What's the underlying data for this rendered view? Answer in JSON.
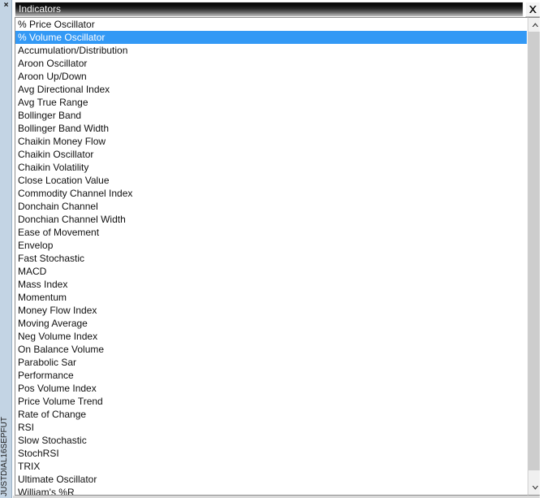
{
  "window": {
    "title": "Indicators",
    "close_icon": "close-icon",
    "close_label": "×"
  },
  "side_strip": {
    "close_label": "×",
    "close_icon": "close-icon",
    "label": "JUSTDIAL16SEPFUT"
  },
  "scrollbar": {
    "up_icon": "chevron-up-icon",
    "down_icon": "chevron-down-icon"
  },
  "colors": {
    "selection": "#3399f5",
    "selection_text": "#ffffff",
    "titlebar_text": "#ffffff",
    "list_background": "#ffffff",
    "list_text": "#101010",
    "side_strip": "#c3d4e4",
    "scrollbar_thumb": "#cdcdcd"
  },
  "list": {
    "selected_index": 1,
    "items": [
      "% Price Oscillator",
      "% Volume Oscillator",
      "Accumulation/Distribution",
      "Aroon Oscillator",
      "Aroon Up/Down",
      "Avg Directional Index",
      "Avg True Range",
      "Bollinger Band",
      "Bollinger Band Width",
      "Chaikin Money Flow",
      "Chaikin Oscillator",
      "Chaikin Volatility",
      "Close Location Value",
      "Commodity Channel Index",
      "Donchain Channel",
      "Donchian Channel Width",
      "Ease of Movement",
      "Envelop",
      "Fast Stochastic",
      "MACD",
      "Mass Index",
      "Momentum",
      "Money Flow Index",
      "Moving Average",
      "Neg Volume Index",
      "On Balance Volume",
      "Parabolic Sar",
      "Performance",
      "Pos Volume Index",
      "Price Volume Trend",
      "Rate of Change",
      "RSI",
      "Slow Stochastic",
      "StochRSI",
      "TRIX",
      "Ultimate Oscillator",
      "William's %R"
    ]
  }
}
